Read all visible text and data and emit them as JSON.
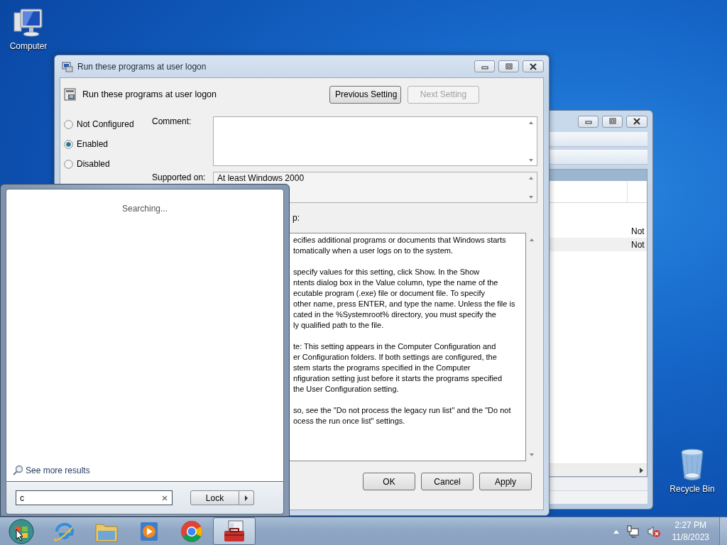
{
  "desktop_icons": [
    {
      "label": "Computer",
      "kind": "computer"
    },
    {
      "label": "Recycle Bin",
      "kind": "recycle-bin"
    }
  ],
  "back_window": {
    "rows": [
      {
        "column_2": "Not",
        "selected": false
      },
      {
        "column_2": "Not",
        "selected": true
      }
    ]
  },
  "dialog": {
    "title": "Run these programs at user logon",
    "heading": "Run these programs at user logon",
    "nav_buttons": [
      {
        "label": "Previous Setting",
        "disabled": false
      },
      {
        "label": "Next Setting",
        "disabled": true
      }
    ],
    "state_options": [
      {
        "label": "Not Configured",
        "selected": false
      },
      {
        "label": "Enabled",
        "selected": true
      },
      {
        "label": "Disabled",
        "selected": false
      }
    ],
    "comment_label": "Comment:",
    "supported_label": "Supported on:",
    "supported_value": "At least Windows 2000",
    "help_label": "p:",
    "help_paragraphs": [
      [
        "ecifies additional programs or documents that Windows starts",
        "tomatically when a user logs on to the system."
      ],
      [
        "specify values for this setting, click Show. In the Show",
        "ntents dialog box in the Value column, type the name of the",
        "ecutable program (.exe) file or document file. To specify",
        "other name, press ENTER, and type the name. Unless the file is",
        "cated in the %Systemroot% directory, you must specify the",
        "ly qualified path to the file."
      ],
      [
        "te: This setting appears in the Computer Configuration and",
        "er Configuration folders. If both settings are configured, the",
        "stem starts the programs specified in the Computer",
        "nfiguration setting just before it starts the programs specified",
        "the User Configuration setting."
      ],
      [
        "so, see the \"Do not process the legacy run list\" and the \"Do not",
        "ocess the run once list\" settings."
      ]
    ],
    "buttons": [
      "OK",
      "Cancel",
      "Apply"
    ]
  },
  "start_menu": {
    "status": "Searching...",
    "more_results": "See more results",
    "search": {
      "value": "c"
    },
    "power_button": "Lock"
  },
  "taskbar": {
    "apps": [
      {
        "kind": "ie",
        "active": false
      },
      {
        "kind": "folder",
        "active": false
      },
      {
        "kind": "media",
        "active": false
      },
      {
        "kind": "chrome",
        "active": false
      },
      {
        "kind": "toolbox",
        "active": true
      }
    ],
    "clock": {
      "time": "2:27 PM",
      "date": "11/8/2023"
    }
  }
}
